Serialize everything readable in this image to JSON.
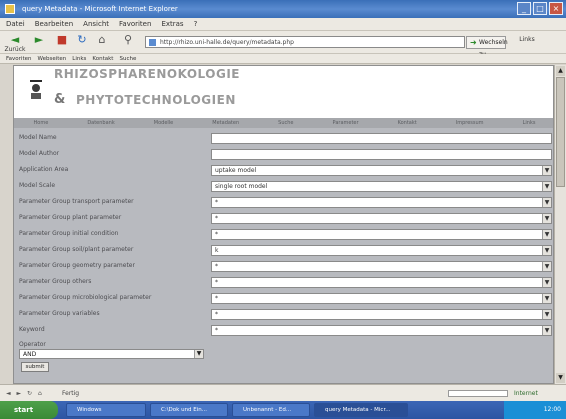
{
  "window": {
    "title": "query Metadata - Microsoft Internet Explorer",
    "min": "_",
    "max": "□",
    "close": "×"
  },
  "menu": [
    "Datei",
    "Bearbeiten",
    "Ansicht",
    "Favoriten",
    "Extras",
    "?"
  ],
  "toolbar": {
    "back": "Zurück",
    "forward": "",
    "stop": "",
    "reload": "",
    "home": "",
    "search": "Suchen",
    "address": "http://rhizo.uni-halle.de/query/metadata.php",
    "go": "Wechseln zu",
    "links": "Links"
  },
  "links": [
    "Favoriten",
    "Webseiten",
    "Links",
    "Kontakt",
    "Suche"
  ],
  "header": {
    "title_top": "RHIZOSPHARENOKOLOGIE",
    "amp": "&",
    "title_bottom": "PHYTOTECHNOLOGIEN"
  },
  "nav": [
    "Home",
    "Datenbank",
    "Modelle",
    "Metadaten",
    "Suche",
    "Parameter",
    "Kontakt",
    "Impressum",
    "Links"
  ],
  "form": {
    "rows": [
      {
        "label": "Model Name",
        "value": "",
        "type": "text"
      },
      {
        "label": "Model Author",
        "value": "",
        "type": "text"
      },
      {
        "label": "Application Area",
        "value": "uptake model",
        "type": "select"
      },
      {
        "label": "Model Scale",
        "value": "single root model",
        "type": "select"
      },
      {
        "label": "Parameter Group transport parameter",
        "value": "*",
        "type": "select"
      },
      {
        "label": "Parameter Group plant parameter",
        "value": "*",
        "type": "select"
      },
      {
        "label": "Parameter Group initial condition",
        "value": "*",
        "type": "select"
      },
      {
        "label": "Parameter Group soil/plant parameter",
        "value": "k",
        "type": "select"
      },
      {
        "label": "Parameter Group geometry parameter",
        "value": "*",
        "type": "select"
      },
      {
        "label": "Parameter Group others",
        "value": "*",
        "type": "select"
      },
      {
        "label": "Parameter Group microbiological parameter",
        "value": "*",
        "type": "select"
      },
      {
        "label": "Parameter Group variables",
        "value": "*",
        "type": "select"
      },
      {
        "label": "Keyword",
        "value": "*",
        "type": "select"
      }
    ],
    "operator_label": "Operator",
    "operator_value": "AND",
    "submit": "submit"
  },
  "status": {
    "icons": "◄ ► ↻ ⌂",
    "text": "Fertig",
    "zone": "Internet"
  },
  "taskbar": {
    "start": "start",
    "tasks": [
      "Windows",
      "C:\\Dok und Ein...",
      "Unbenannt - Ed...",
      "query Metadata - Micr..."
    ],
    "clock": "12:00"
  }
}
